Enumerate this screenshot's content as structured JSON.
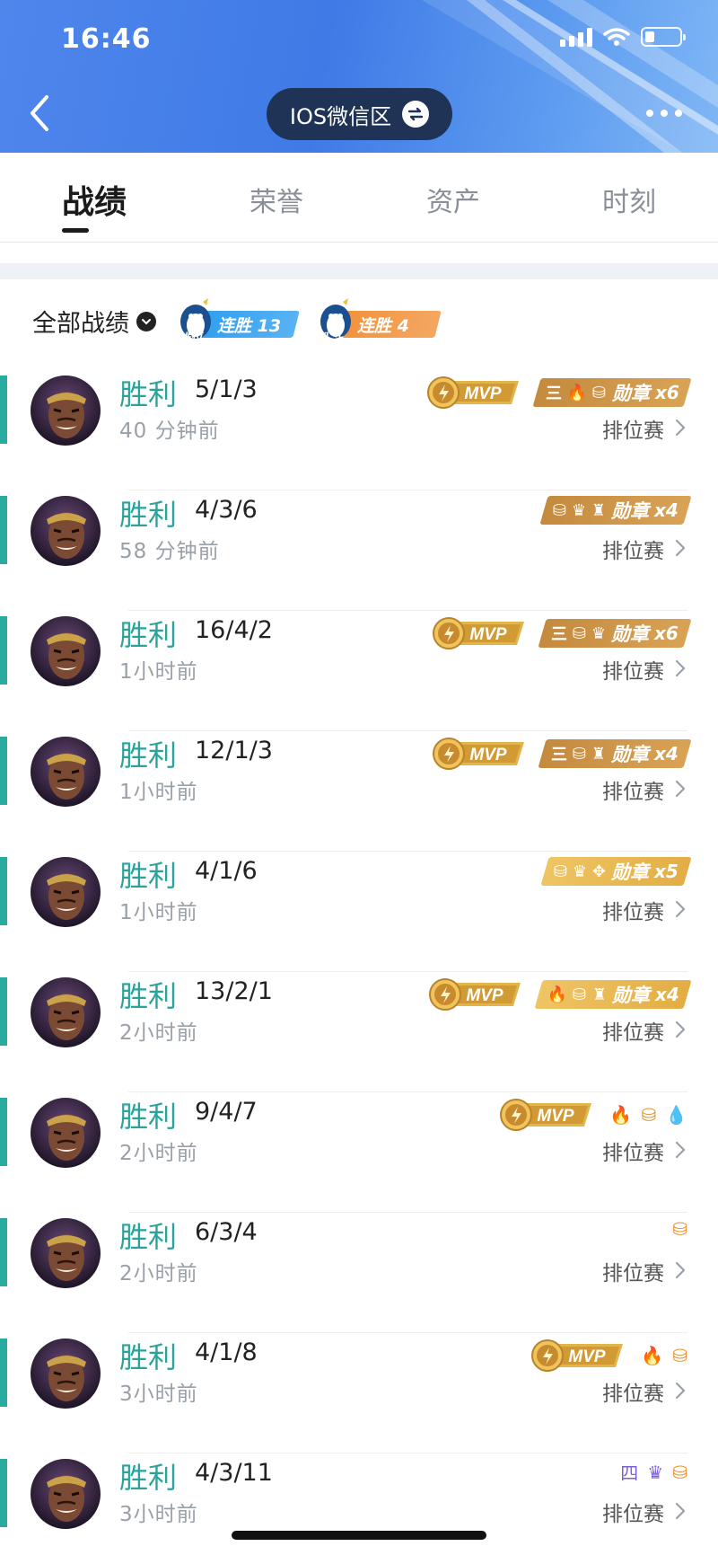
{
  "status_bar": {
    "time": "16:46"
  },
  "header": {
    "server_label": "IOS微信区"
  },
  "tabs": [
    {
      "label": "战绩",
      "active": true
    },
    {
      "label": "荣誉",
      "active": false
    },
    {
      "label": "资产",
      "active": false
    },
    {
      "label": "时刻",
      "active": false
    }
  ],
  "filter": {
    "label": "全部战绩"
  },
  "streaks": [
    {
      "tag": "排位",
      "text": "连胜 13",
      "color": "#2f9ff0"
    },
    {
      "tag": "乱斗",
      "text": "连胜 4",
      "color": "#f2913a"
    }
  ],
  "colors": {
    "accent_teal": "#2aaba0",
    "header_blue": "#4f86ec",
    "medal_gold": "#c48a3e",
    "mvp_gold": "#d9a33c"
  },
  "matches": [
    {
      "result": "胜利",
      "kda": "5/1/3",
      "time": "40 分钟前",
      "mode": "排位赛",
      "mvp": true,
      "medal": {
        "icons": [
          "三",
          "🔥",
          "⛁"
        ],
        "label": "勋章",
        "count": "x6"
      }
    },
    {
      "result": "胜利",
      "kda": "4/3/6",
      "time": "58 分钟前",
      "mode": "排位赛",
      "mvp": false,
      "medal": {
        "icons": [
          "⛁",
          "♛",
          "♜"
        ],
        "label": "勋章",
        "count": "x4"
      }
    },
    {
      "result": "胜利",
      "kda": "16/4/2",
      "time": "1小时前",
      "mode": "排位赛",
      "mvp": true,
      "medal": {
        "icons": [
          "三",
          "⛁",
          "♛"
        ],
        "label": "勋章",
        "count": "x6"
      }
    },
    {
      "result": "胜利",
      "kda": "12/1/3",
      "time": "1小时前",
      "mode": "排位赛",
      "mvp": true,
      "medal": {
        "icons": [
          "三",
          "⛁",
          "♜"
        ],
        "label": "勋章",
        "count": "x4"
      }
    },
    {
      "result": "胜利",
      "kda": "4/1/6",
      "time": "1小时前",
      "mode": "排位赛",
      "mvp": false,
      "medal": {
        "icons": [
          "⛁",
          "♛",
          "✥"
        ],
        "label": "勋章",
        "count": "x5"
      }
    },
    {
      "result": "胜利",
      "kda": "13/2/1",
      "time": "2小时前",
      "mode": "排位赛",
      "mvp": true,
      "medal": {
        "icons": [
          "🔥",
          "⛁",
          "♜"
        ],
        "label": "勋章",
        "count": "x4"
      }
    },
    {
      "result": "胜利",
      "kda": "9/4/7",
      "time": "2小时前",
      "mode": "排位赛",
      "mvp": true,
      "medal": null,
      "mini": [
        "🔥",
        "⛁",
        "💧"
      ]
    },
    {
      "result": "胜利",
      "kda": "6/3/4",
      "time": "2小时前",
      "mode": "排位赛",
      "mvp": false,
      "medal": null,
      "mini": [
        "⛁"
      ]
    },
    {
      "result": "胜利",
      "kda": "4/1/8",
      "time": "3小时前",
      "mode": "排位赛",
      "mvp": true,
      "medal": null,
      "mini": [
        "🔥",
        "⛁"
      ]
    },
    {
      "result": "胜利",
      "kda": "4/3/11",
      "time": "3小时前",
      "mode": "排位赛",
      "mvp": false,
      "medal": null,
      "mini": [
        "四",
        "♛",
        "⛁"
      ]
    }
  ]
}
